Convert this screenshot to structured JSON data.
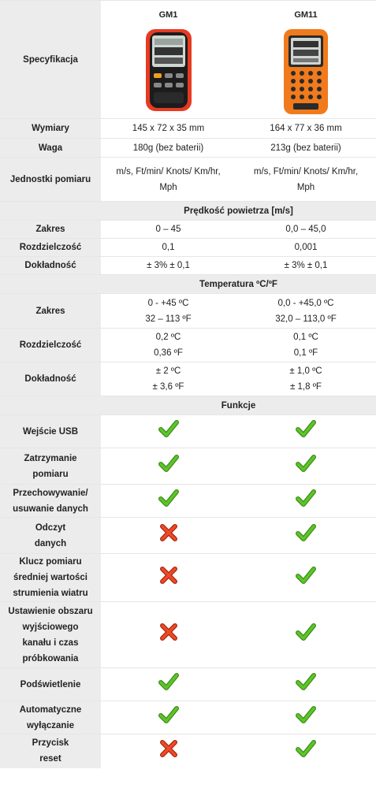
{
  "header": {
    "spec_label": "Specyfikacja",
    "col1": "GM1",
    "col2": "GM11"
  },
  "rows_general": [
    {
      "label": "Wymiary",
      "v1": "145 x 72 x 35 mm",
      "v2": "164 x 77 x 36 mm"
    },
    {
      "label": "Waga",
      "v1": "180g (bez baterii)",
      "v2": "213g (bez baterii)"
    },
    {
      "label": "Jednostki pomiaru",
      "v1a": "m/s, Ft/min/ Knots/ Km/hr,",
      "v1b": "Mph",
      "v2a": "m/s, Ft/min/ Knots/ Km/hr,",
      "v2b": "Mph"
    }
  ],
  "section_speed": "Prędkość powietrza [m/s]",
  "rows_speed": [
    {
      "label": "Zakres",
      "v1": "0 – 45",
      "v2": "0,0 – 45,0"
    },
    {
      "label": "Rozdzielczość",
      "v1": "0,1",
      "v2": "0,001"
    },
    {
      "label": "Dokładność",
      "v1": "± 3% ± 0,1",
      "v2": "± 3% ± 0,1"
    }
  ],
  "section_temp": "Temperatura ºC/ºF",
  "rows_temp": [
    {
      "label": "Zakres",
      "v1a": "0 - +45 ºC",
      "v1b": "32 – 113 ºF",
      "v2a": "0,0 - +45,0 ºC",
      "v2b": "32,0 – 113,0 ºF"
    },
    {
      "label": "Rozdzielczość",
      "v1a": "0,2 ºC",
      "v1b": "0,36 ºF",
      "v2a": "0,1 ºC",
      "v2b": "0,1 ºF"
    },
    {
      "label": "Dokładność",
      "v1a": "± 2 ºC",
      "v1b": "± 3,6 ºF",
      "v2a": "± 1,0 ºC",
      "v2b": "± 1,8 ºF"
    }
  ],
  "section_func": "Funkcje",
  "functions": [
    {
      "l1": "Wejście USB",
      "l2": "",
      "l3": "",
      "l4": "",
      "gm1": "check-icon",
      "gm11": "check-icon"
    },
    {
      "l1": "Zatrzymanie",
      "l2": "pomiaru",
      "l3": "",
      "l4": "",
      "gm1": "check-icon",
      "gm11": "check-icon"
    },
    {
      "l1": "Przechowywanie/",
      "l2": "usuwanie danych",
      "l3": "",
      "l4": "",
      "gm1": "check-icon",
      "gm11": "check-icon"
    },
    {
      "l1": "Odczyt",
      "l2": "danych",
      "l3": "",
      "l4": "",
      "gm1": "cross-icon",
      "gm11": "check-icon"
    },
    {
      "l1": "Klucz pomiaru",
      "l2": "średniej wartości",
      "l3": "strumienia wiatru",
      "l4": "",
      "gm1": "cross-icon",
      "gm11": "check-icon"
    },
    {
      "l1": "Ustawienie obszaru",
      "l2": "wyjściowego",
      "l3": "kanału i czas",
      "l4": "próbkowania",
      "gm1": "cross-icon",
      "gm11": "check-icon"
    },
    {
      "l1": "Podświetlenie",
      "l2": "",
      "l3": "",
      "l4": "",
      "gm1": "check-icon",
      "gm11": "check-icon"
    },
    {
      "l1": "Automatyczne",
      "l2": "wyłączanie",
      "l3": "",
      "l4": "",
      "gm1": "check-icon",
      "gm11": "check-icon"
    },
    {
      "l1": "Przycisk",
      "l2": "reset",
      "l3": "",
      "l4": "",
      "gm1": "cross-icon",
      "gm11": "check-icon"
    }
  ],
  "colors": {
    "label_bg": "#ececec",
    "check": "#4caf1e",
    "cross": "#e33b1f",
    "device_orange": "#f07a1c",
    "device_red": "#e63a22"
  }
}
